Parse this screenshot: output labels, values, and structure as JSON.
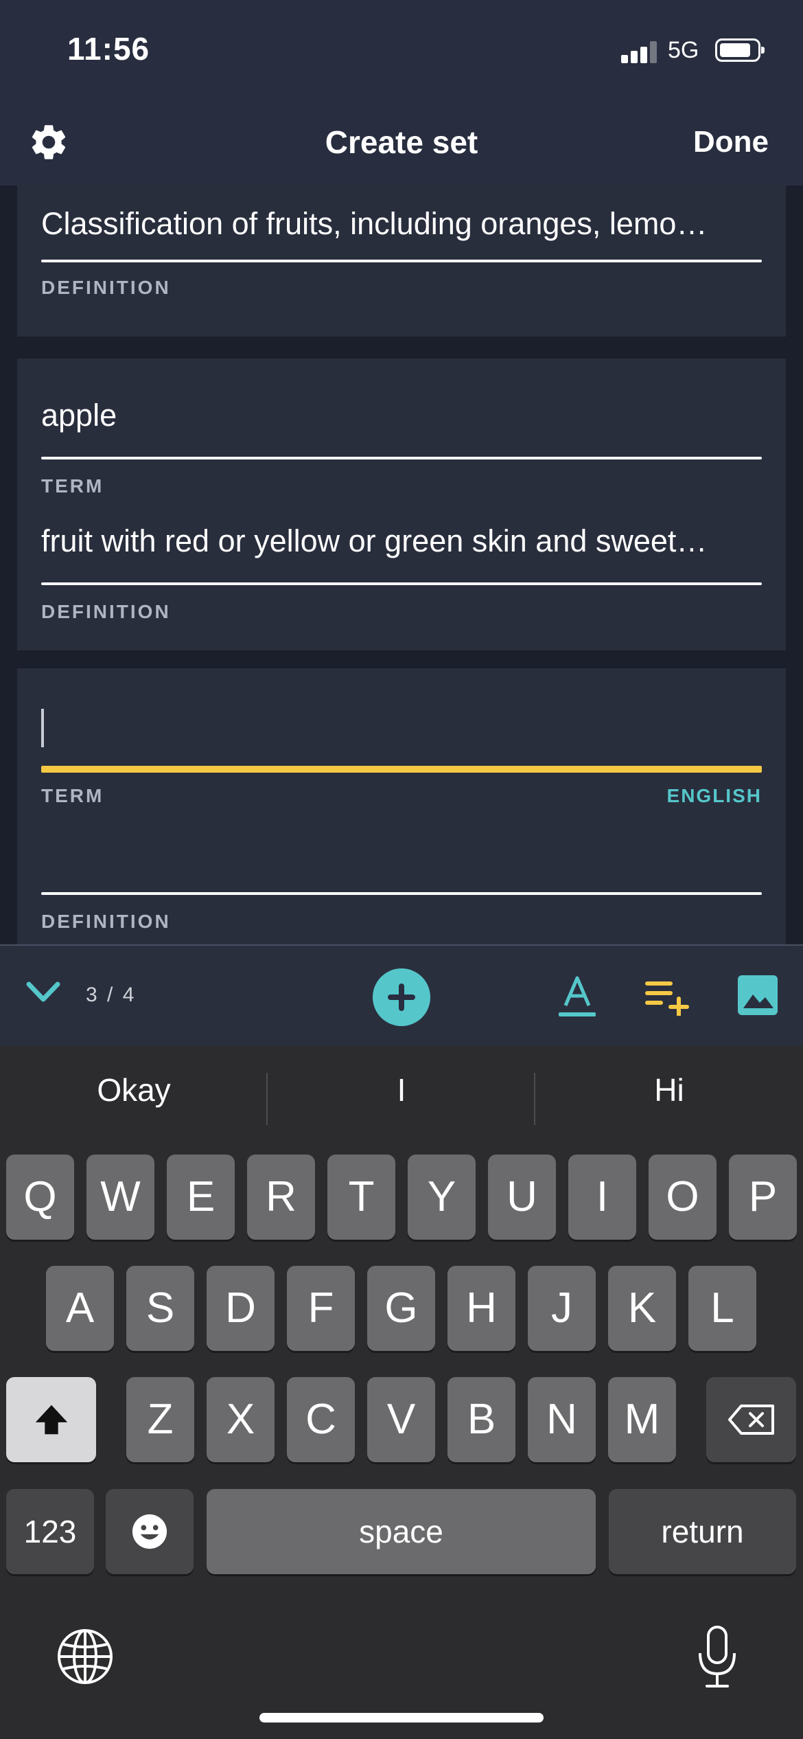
{
  "status_bar": {
    "time": "11:56",
    "network": "5G"
  },
  "nav": {
    "title": "Create set",
    "done_label": "Done"
  },
  "cards": [
    {
      "definition_value": "Classification of fruits, including oranges, lemo…",
      "definition_label": "DEFINITION"
    },
    {
      "term_value": "apple",
      "term_label": "TERM",
      "definition_value": "fruit with red or yellow or green skin and sweet…",
      "definition_label": "DEFINITION"
    },
    {
      "term_value": "",
      "term_label": "TERM",
      "term_language": "ENGLISH",
      "definition_value": "",
      "definition_label": "DEFINITION"
    }
  ],
  "toolbar": {
    "counter": "3 / 4"
  },
  "keyboard": {
    "suggestions": [
      "Okay",
      "I",
      "Hi"
    ],
    "row1": [
      "Q",
      "W",
      "E",
      "R",
      "T",
      "Y",
      "U",
      "I",
      "O",
      "P"
    ],
    "row2": [
      "A",
      "S",
      "D",
      "F",
      "G",
      "H",
      "J",
      "K",
      "L"
    ],
    "row3": [
      "Z",
      "X",
      "C",
      "V",
      "B",
      "N",
      "M"
    ],
    "numbers_label": "123",
    "space_label": "space",
    "return_label": "return"
  },
  "colors": {
    "accent_teal": "#55c7cb",
    "active_yellow": "#f6c944",
    "background": "#282e3f"
  }
}
